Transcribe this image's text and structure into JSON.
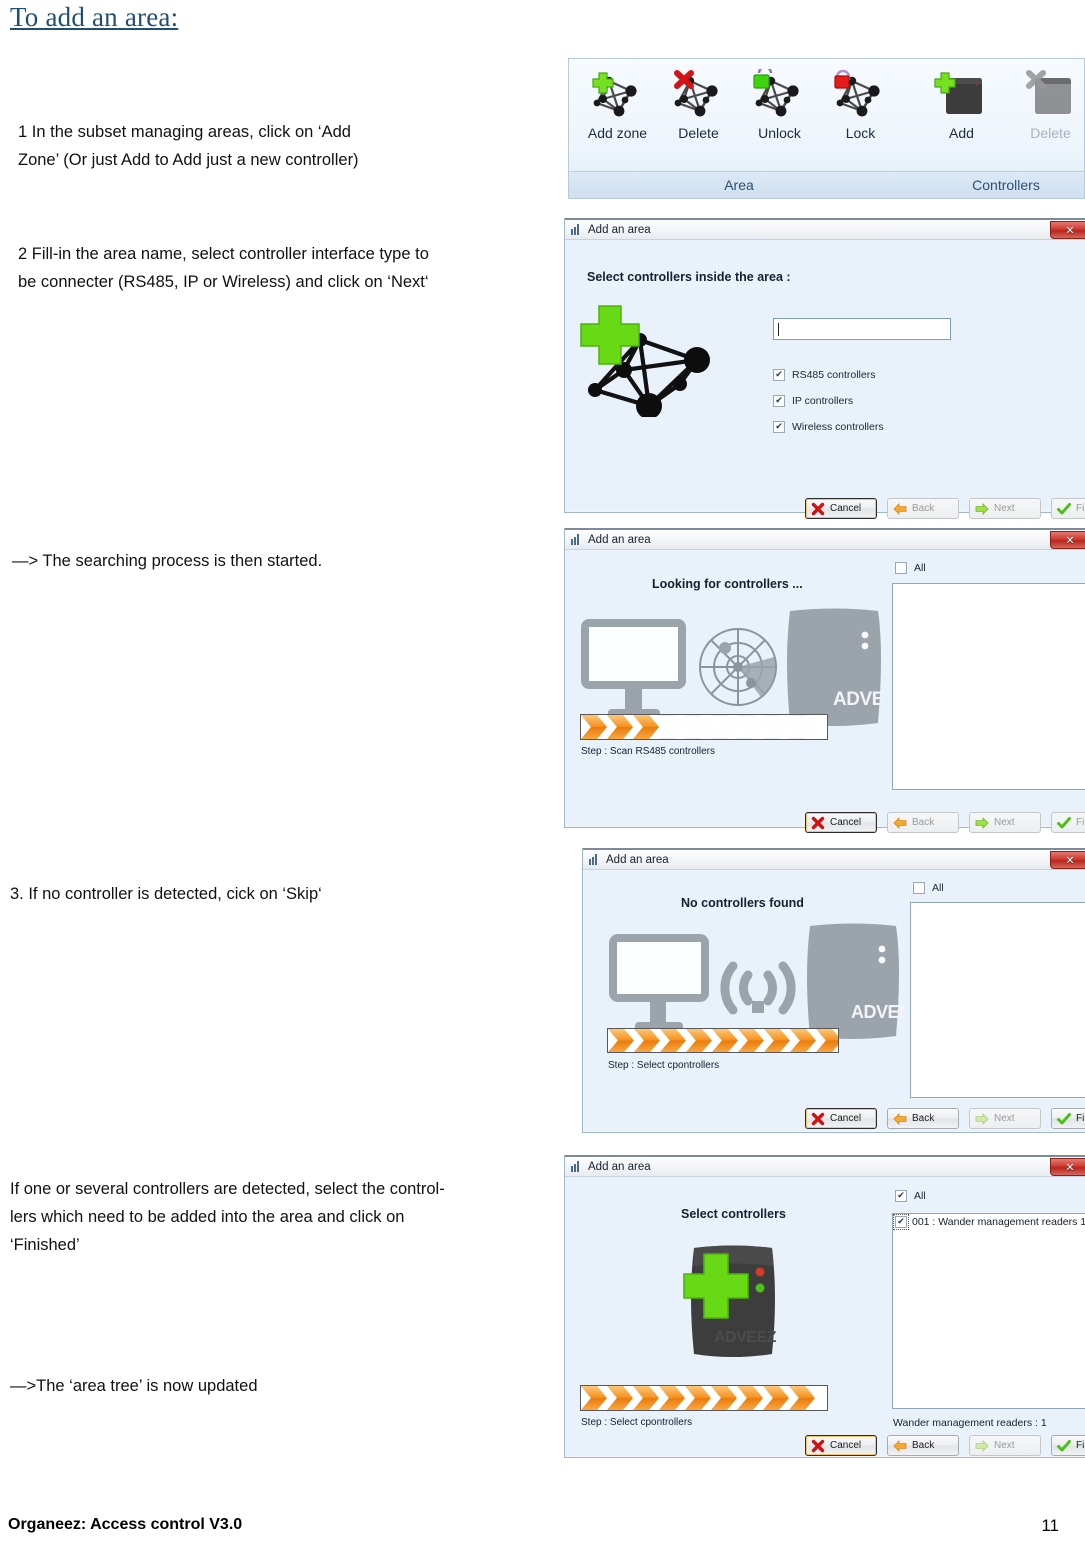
{
  "document": {
    "title": "To add an area:",
    "steps": [
      {
        "id": "step1",
        "text": "1         In the subset managing areas, click on ‘Add\n       Zone’ (Or just Add to Add just a new controller)"
      },
      {
        "id": "step2",
        "text": "2         Fill-in the area name, select controller interface type to\n          be connecter (RS485, IP or Wireless) and click on ‘Next‘"
      },
      {
        "id": "note1",
        "text": "—> The searching process is then started."
      },
      {
        "id": "step3",
        "text": "3.                  If no controller is detected, cick on ‘Skip‘"
      },
      {
        "id": "step4",
        "text": "If one or several controllers are detected, select the control-\nlers which need to be added into the area and click on\n‘Finished’"
      },
      {
        "id": "note2",
        "text": "—>The ‘area tree’ is now updated"
      }
    ],
    "footer": {
      "left": "Organeez: Access control     V3.0",
      "page": "11"
    }
  },
  "ribbon": {
    "groups": [
      {
        "name": "Area",
        "items": [
          {
            "label": "Add zone",
            "icon": "network-add-icon",
            "disabled": false
          },
          {
            "label": "Delete",
            "icon": "network-delete-icon",
            "disabled": false
          },
          {
            "label": "Unlock",
            "icon": "network-unlock-icon",
            "disabled": false
          },
          {
            "label": "Lock",
            "icon": "network-lock-icon",
            "disabled": false
          }
        ]
      },
      {
        "name": "Controllers",
        "items": [
          {
            "label": "Add",
            "icon": "controller-add-icon",
            "disabled": false
          },
          {
            "label": "Delete",
            "icon": "controller-delete-icon",
            "disabled": true
          }
        ]
      }
    ]
  },
  "dialog_common": {
    "title": "Add an area",
    "title_icon": "bars-icon",
    "close_label": "✕",
    "buttons": {
      "cancel": "Cancel",
      "back": "Back",
      "next": "Next",
      "finish": "Finish"
    }
  },
  "dialog_select_controllers": {
    "heading": "Select controllers inside the area :",
    "name_field": {
      "value": "",
      "placeholder": ""
    },
    "checkboxes": [
      {
        "label": "RS485 controllers",
        "checked": true
      },
      {
        "label": "IP controllers",
        "checked": true
      },
      {
        "label": "Wireless controllers",
        "checked": true
      }
    ],
    "buttons_state": {
      "cancel": "enabled",
      "back": "disabled",
      "next": "disabled",
      "finish": "disabled"
    },
    "graphic": "mesh-network-add-icon"
  },
  "dialog_looking": {
    "heading": "Looking for controllers ...",
    "all_label": "All",
    "all_checked": false,
    "list_items": [],
    "step_label": "Step : Scan RS485 controllers",
    "progress": {
      "total": 9,
      "filled": 3
    },
    "device_label": "ADVEEZ",
    "graphic": "computer-radar-reader-icon",
    "buttons_state": {
      "cancel": "enabled",
      "back": "disabled",
      "next": "disabled",
      "finish": "disabled"
    }
  },
  "dialog_none_found": {
    "heading": "No controllers found",
    "all_label": "All",
    "all_checked": false,
    "list_items": [],
    "step_label": "Step : Select cpontrollers",
    "progress": {
      "total": 9,
      "filled": 9
    },
    "device_label": "ADVEEZ",
    "graphic": "computer-wifi-reader-icon",
    "buttons_state": {
      "cancel": "enabled",
      "back": "enabled",
      "next": "disabled",
      "finish": "enabled"
    }
  },
  "dialog_found": {
    "heading": "Select controllers",
    "all_label": "All",
    "all_checked": true,
    "list_items": [
      {
        "label": "001 : Wander management readers 1",
        "checked": true
      }
    ],
    "count_label": "Wander management readers  : 1",
    "step_label": "Step : Select cpontrollers",
    "progress": {
      "total": 9,
      "filled": 9
    },
    "device_label": "ADVEEZ",
    "graphic": "reader-add-icon",
    "buttons_state": {
      "cancel": "enabled",
      "back": "enabled",
      "next": "disabled",
      "finish": "enabled"
    }
  },
  "colors": {
    "title_blue": "#1f4e79",
    "dialog_bg": "#e9f1fb",
    "accent_orange": "#f69220",
    "accent_green": "#5fd21a",
    "close_red": "#cf3a30"
  }
}
